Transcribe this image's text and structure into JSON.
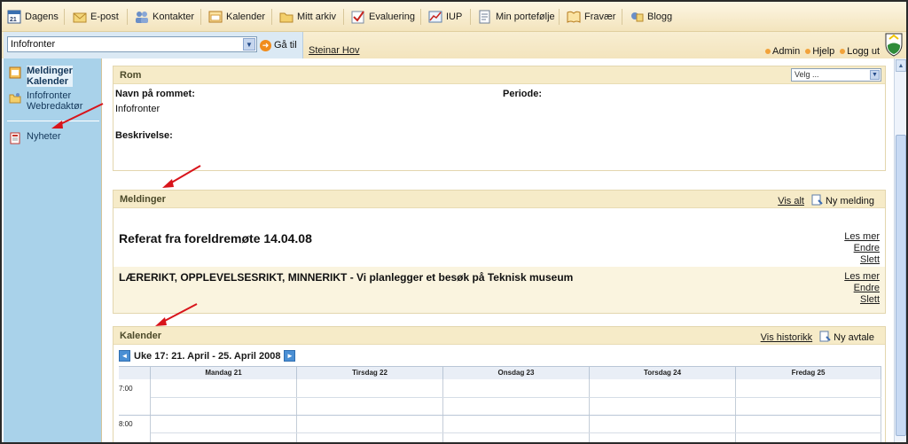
{
  "topnav": {
    "items": [
      {
        "label": "Dagens",
        "icon": "calendar-21-icon"
      },
      {
        "label": "E-post",
        "icon": "envelope-icon"
      },
      {
        "label": "Kontakter",
        "icon": "contacts-icon"
      },
      {
        "label": "Kalender",
        "icon": "calendar-icon"
      },
      {
        "label": "Mitt arkiv",
        "icon": "archive-icon"
      },
      {
        "label": "Evaluering",
        "icon": "checkmark-icon"
      },
      {
        "label": "IUP",
        "icon": "chart-icon"
      },
      {
        "label": "Min portefølje",
        "icon": "portfolio-icon"
      },
      {
        "label": "Fravær",
        "icon": "book-icon"
      },
      {
        "label": "Blogg",
        "icon": "blog-icon"
      }
    ]
  },
  "subbar": {
    "select_value": "Infofronter",
    "goto_label": "Gå til",
    "user_name": "Steinar Hov",
    "links": [
      "Admin",
      "Hjelp",
      "Logg ut"
    ]
  },
  "sidebar": {
    "items": [
      {
        "label": "Meldinger",
        "label2": "Kalender"
      },
      {
        "label": "Infofronter",
        "label2": "Webredaktør"
      },
      {
        "label": "Nyheter"
      }
    ]
  },
  "room": {
    "title": "Rom",
    "select_value": "Velg ...",
    "name_label": "Navn på rommet:",
    "name_value": "Infofronter",
    "period_label": "Periode:",
    "desc_label": "Beskrivelse:"
  },
  "messages": {
    "title": "Meldinger",
    "show_all": "Vis alt",
    "new_message": "Ny melding",
    "items": [
      {
        "title": "Referat fra foreldremøte 14.04.08",
        "actions": [
          "Les mer",
          "Endre",
          "Slett"
        ]
      },
      {
        "title": "LÆRERIKT, OPPLEVELSESRIKT, MINNERIKT - Vi planlegger et besøk på Teknisk museum",
        "actions": [
          "Les mer",
          "Endre",
          "Slett"
        ]
      }
    ]
  },
  "calendar": {
    "title": "Kalender",
    "show_history": "Vis historikk",
    "new_appointment": "Ny avtale",
    "week_label": "Uke 17: 21. April - 25. April 2008",
    "days": [
      "Mandag 21",
      "Tirsdag 22",
      "Onsdag 23",
      "Torsdag 24",
      "Fredag 25"
    ],
    "times": [
      "7:00",
      "8:00"
    ]
  },
  "colors": {
    "sidebar_bg": "#a9d2ea",
    "panel_head_bg": "#f6ebc8",
    "accent_orange": "#f08c1c",
    "annotation_red": "#d8141b"
  }
}
